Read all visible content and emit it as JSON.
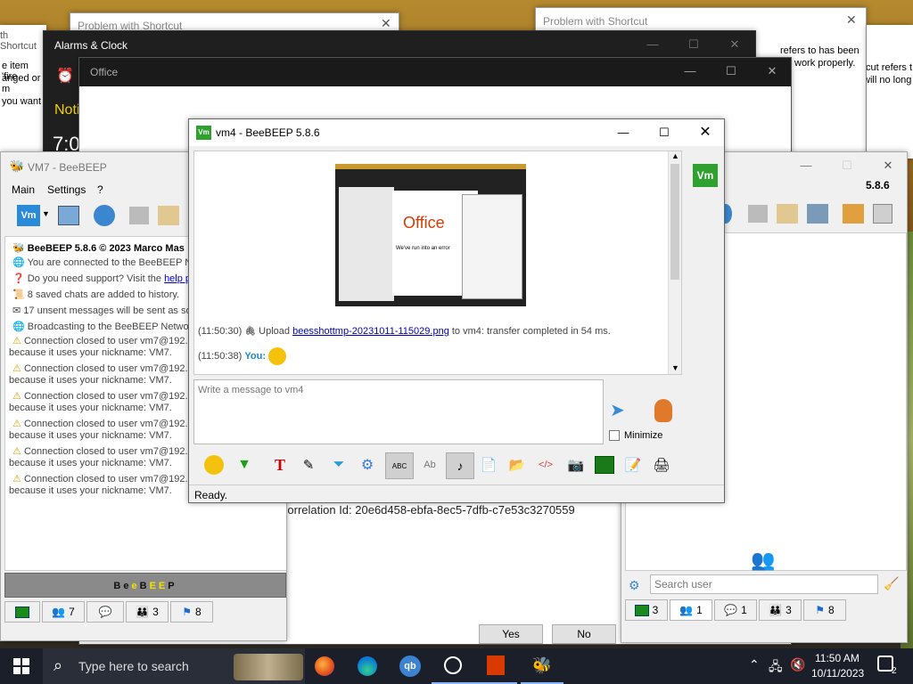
{
  "warning_windows": {
    "left_title_fragment": "th Shortcut",
    "left_text": [
      "e item 'fire",
      "anged or m",
      "you want"
    ],
    "win_a_title": "Problem with Shortcut",
    "win_b_title": "Problem with Shortcut",
    "right_text_a": [
      "refers to has been",
      "work properly."
    ],
    "right_text_b": [
      "tcut refers t",
      "will no long"
    ]
  },
  "alarms": {
    "title": "Alarms & Clock",
    "notif_fragment": "Noti",
    "time_fragment": "7:0"
  },
  "office": {
    "title": "Office",
    "correlation": "Correlation Id: 20e6d458-ebfa-8ec5-7dfb-c7e53c3270559",
    "yes": "Yes",
    "no": "No"
  },
  "vm7": {
    "title": "VM7 - BeeBEEP",
    "menu": [
      "Main",
      "Settings",
      "?"
    ],
    "messages": [
      "BeeBEEP 5.8.6 © 2023 Marco Mas",
      "You are connected to the BeeBEEP Ne",
      "Do you need support? Visit the",
      "help pa",
      "8 saved chats are added to history.",
      "17 unsent messages will be sent as so",
      "Broadcasting to the BeeBEEP Network",
      "Connection closed to user vm7@192.1",
      "because it uses your nickname: VM7."
    ],
    "banner_letters": [
      "B",
      "e",
      "e",
      "B",
      "E",
      "E",
      "P"
    ],
    "tabs": [
      {
        "icon": "monitor-icon",
        "count": ""
      },
      {
        "icon": "users-icon",
        "count": "7"
      },
      {
        "icon": "chat-bubbles-icon",
        "count": ""
      },
      {
        "icon": "groups-icon",
        "count": "3"
      },
      {
        "icon": "flag-icon",
        "count": "8"
      }
    ]
  },
  "right_beebeep": {
    "version": "5.8.6",
    "avatar": "Vm",
    "search_placeholder": "Search user",
    "tabs": [
      {
        "icon": "monitor-icon",
        "count": "3"
      },
      {
        "icon": "users-icon",
        "count": "1"
      },
      {
        "icon": "chat-bubbles-icon",
        "count": "1"
      },
      {
        "icon": "groups-icon",
        "count": "3"
      },
      {
        "icon": "flag-icon",
        "count": "8"
      }
    ]
  },
  "chat": {
    "title": "vm4 - BeeBEEP 5.8.6",
    "avatar": "Vm",
    "thumb_text": "Office",
    "thumb_error": "We've run into an error",
    "entries": [
      {
        "time": "(11:50:30)",
        "prefix": "Upload",
        "link": "beesshottmp-20231011-115029.png",
        "suffix": "to vm4: transfer completed in 54 ms."
      },
      {
        "time": "(11:50:38)",
        "sender": "You:"
      }
    ],
    "input_placeholder": "Write a message to vm4",
    "minimize_label": "Minimize",
    "status": "Ready."
  },
  "taskbar": {
    "search_placeholder": "Type here to search",
    "time": "11:50 AM",
    "date": "10/11/2023",
    "notifications": "2"
  },
  "colors": {
    "accent": "#0a6bd6",
    "beebeep_green": "#2ea12e",
    "desktop": "#8a5b1a",
    "taskbar": "#1b1f2a"
  }
}
